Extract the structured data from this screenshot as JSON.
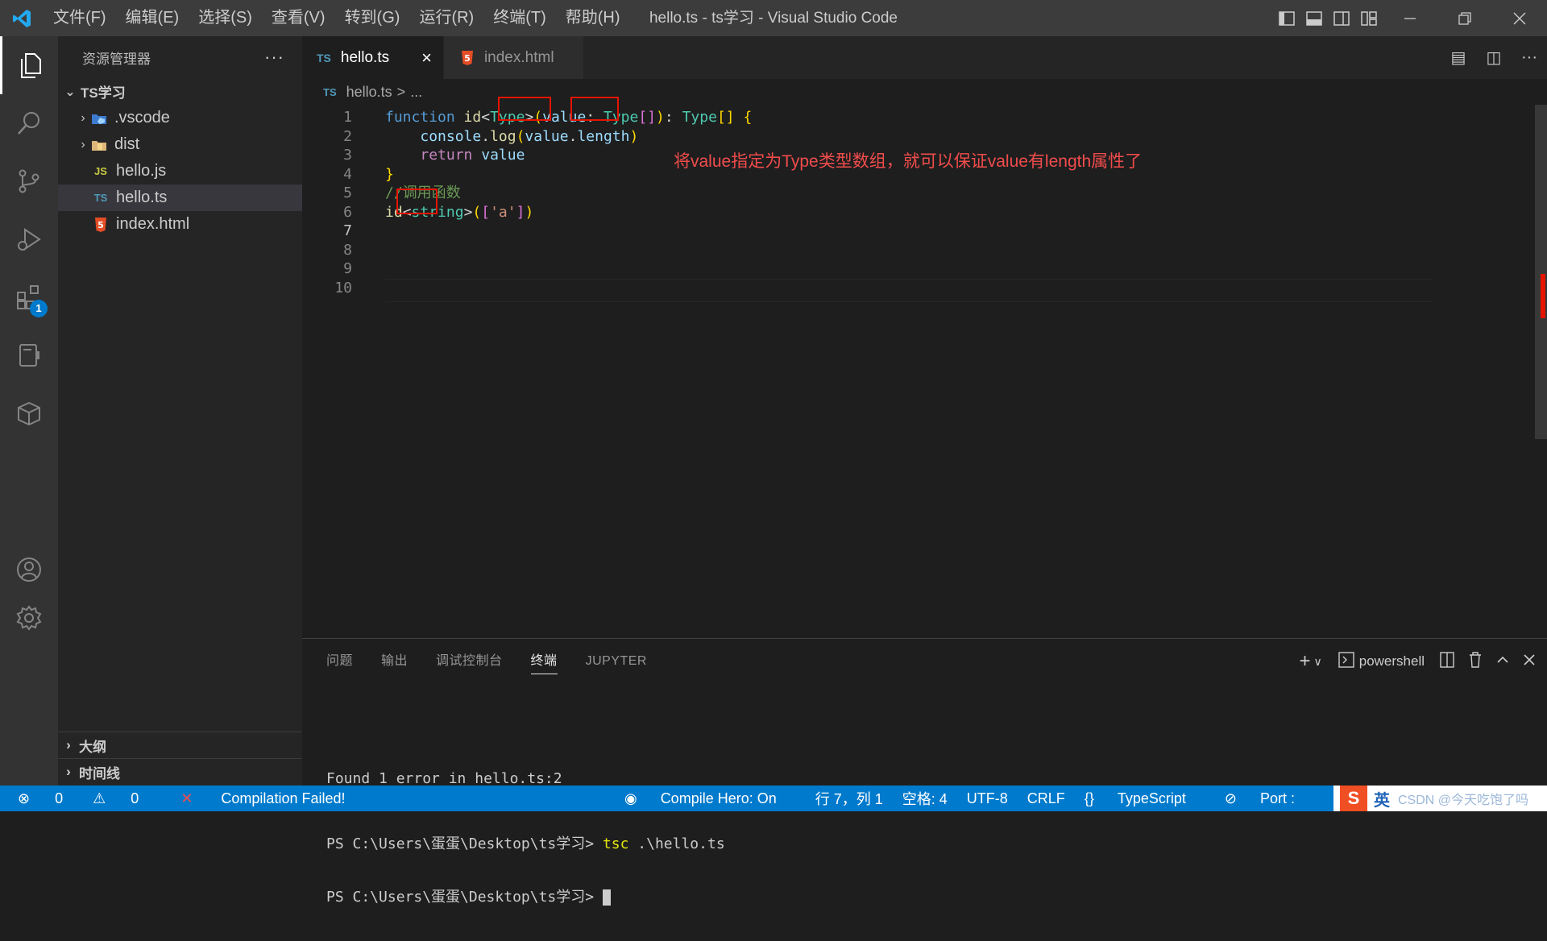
{
  "window": {
    "title": "hello.ts - ts学习 - Visual Studio Code"
  },
  "menu": [
    "文件(F)",
    "编辑(E)",
    "选择(S)",
    "查看(V)",
    "转到(G)",
    "运行(R)",
    "终端(T)",
    "帮助(H)"
  ],
  "activity_bar": {
    "items": [
      "explorer-icon",
      "search-icon",
      "source-control-icon",
      "run-debug-icon",
      "extensions-icon",
      "remote-icon",
      "package-icon"
    ],
    "extensions_badge": "1",
    "bottom": [
      "account-icon",
      "settings-gear-icon"
    ]
  },
  "sidebar": {
    "title": "资源管理器",
    "more": "···",
    "root": "TS学习",
    "items": [
      {
        "label": ".vscode",
        "type": "folder",
        "icon": "vscode-folder-icon"
      },
      {
        "label": "dist",
        "type": "folder",
        "icon": "folder-icon"
      },
      {
        "label": "hello.js",
        "type": "file",
        "badge": "JS"
      },
      {
        "label": "hello.ts",
        "type": "file",
        "badge": "TS",
        "selected": true
      },
      {
        "label": "index.html",
        "type": "file",
        "badge": "5"
      }
    ],
    "outline": "大纲",
    "timeline": "时间线"
  },
  "tabs": [
    {
      "label": "hello.ts",
      "badge": "TS",
      "active": true,
      "close": "×"
    },
    {
      "label": "index.html",
      "badge": "5",
      "active": false
    }
  ],
  "tab_actions": [
    "▤",
    "◫",
    "···"
  ],
  "breadcrumb": {
    "badge": "TS",
    "file": "hello.ts",
    "sep": ">",
    "more": "..."
  },
  "code": {
    "line_numbers": [
      "1",
      "2",
      "3",
      "4",
      "5",
      "6",
      "7",
      "8",
      "9",
      "10"
    ],
    "current_line": 7,
    "lines": [
      "function id<Type>(value: Type[]): Type[] {",
      "    console.log(value.length)",
      "    return value",
      "}",
      "//调用函数",
      "id<string>(['a'])",
      "",
      "",
      "",
      ""
    ],
    "annotation": "将value指定为Type类型数组，就可以保证value有length属性了"
  },
  "panel": {
    "tabs": [
      "问题",
      "输出",
      "调试控制台",
      "终端",
      "JUPYTER"
    ],
    "active_tab": "终端",
    "shell": "powershell",
    "terminal": {
      "line1": "Found 1 error in hello.ts:2",
      "line2_prompt": "PS C:\\Users\\蛋蛋\\Desktop\\ts学习> ",
      "line2_cmd": "tsc",
      "line2_args": " .\\hello.ts",
      "line3_prompt": "PS C:\\Users\\蛋蛋\\Desktop\\ts学习> "
    }
  },
  "statusbar": {
    "errors": "0",
    "warnings": "0",
    "compile": "Compilation Failed!",
    "compile_hero": "Compile Hero: On",
    "position": "行 7，列 1",
    "spaces": "空格: 4",
    "encoding": "UTF-8",
    "eol": "CRLF",
    "language": "TypeScript",
    "port": "Port :",
    "ime": "英",
    "watermark": "CSDN @今天吃饱了吗"
  },
  "colors": {
    "accent": "#007acc",
    "error_red": "#e51400",
    "annotation_red": "#f14c4c"
  }
}
